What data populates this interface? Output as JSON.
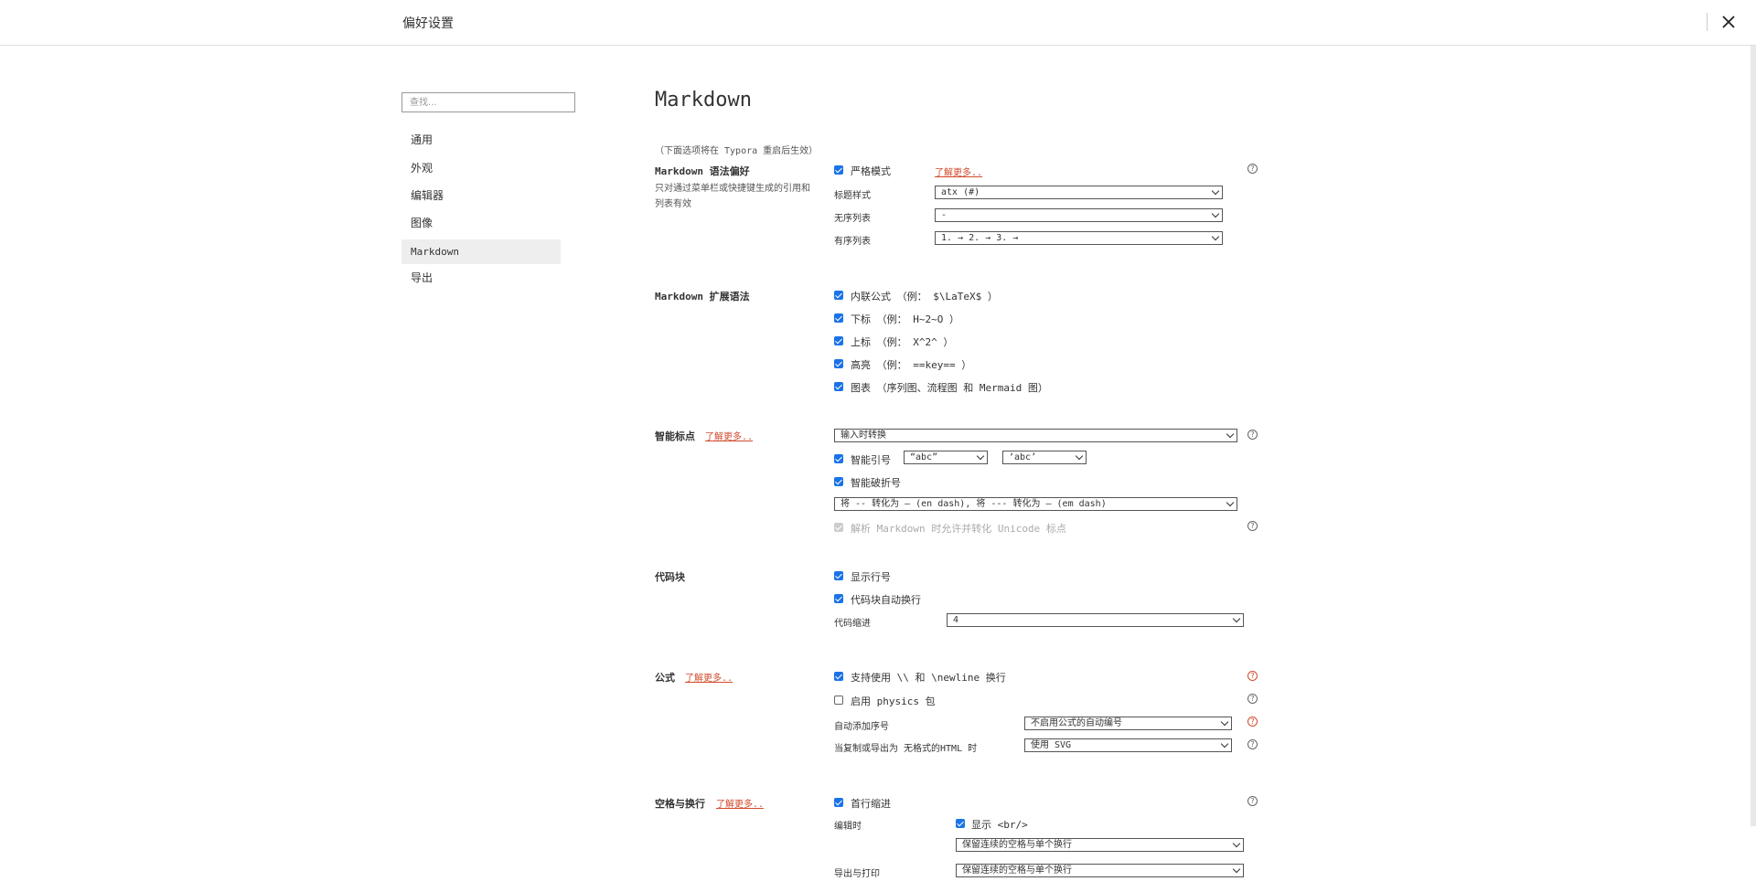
{
  "window": {
    "title": "偏好设置",
    "close_icon": "close-icon"
  },
  "search": {
    "placeholder": "查找..."
  },
  "sidebar": {
    "items": [
      {
        "label": "通用"
      },
      {
        "label": "外观"
      },
      {
        "label": "编辑器"
      },
      {
        "label": "图像"
      },
      {
        "label": "Markdown",
        "active": true
      },
      {
        "label": "导出"
      }
    ]
  },
  "page": {
    "title": "Markdown",
    "restart_note": "（下面选项将在 Typora 重启后生效）"
  },
  "syntax_pref": {
    "title": "Markdown 语法偏好",
    "desc": "只对通过菜单栏或快捷键生成的引用和列表有效",
    "strict_label": "严格模式",
    "learn_more": "了解更多..",
    "heading_style_label": "标题样式",
    "heading_style_value": "atx (#)",
    "unordered_label": "无序列表",
    "unordered_value": "-",
    "ordered_label": "有序列表",
    "ordered_value": "1. → 2. → 3. →"
  },
  "ext_syntax": {
    "title": "Markdown 扩展语法",
    "items": [
      "内联公式 （例： $\\LaTeX$ ）",
      "下标 （例： H~2~O ）",
      "上标 （例： X^2^ ）",
      "高亮 （例： ==key== ）",
      "图表  （序列图、流程图 和 Mermaid 图）"
    ]
  },
  "smart_punct": {
    "title": "智能标点",
    "learn_more": "了解更多..",
    "mode_value": "输入时转换",
    "smart_quotes_label": "智能引号",
    "double_quote_value": "“abc”",
    "single_quote_value": "‘abc’",
    "smart_dash_label": "智能破折号",
    "dash_value": "将 -- 转化为 – (en dash), 将 --- 转化为 — (em dash)",
    "unicode_label": "解析 Markdown 时允许并转化 Unicode 标点"
  },
  "code_block": {
    "title": "代码块",
    "line_numbers_label": "显示行号",
    "wrap_label": "代码块自动换行",
    "indent_label": "代码缩进",
    "indent_value": "4"
  },
  "math": {
    "title": "公式",
    "learn_more": "了解更多..",
    "newline_label": "支持使用 \\\\ 和 \\newline 换行",
    "physics_label": "启用 physics 包",
    "auto_number_label": "自动添加序号",
    "auto_number_value": "不启用公式的自动编号",
    "export_label": "当复制或导出为 无格式的HTML 时",
    "export_value": "使用 SVG"
  },
  "whitespace": {
    "title": "空格与换行",
    "learn_more": "了解更多..",
    "first_indent_label": "首行缩进",
    "edit_label": "编辑时",
    "show_br_label": "显示 <br/>",
    "edit_value": "保留连续的空格与单个换行",
    "export_label": "导出与打印",
    "export_value": "保留连续的空格与单个换行"
  },
  "colors": {
    "accent": "#1a73e8",
    "link": "#d24a2c"
  }
}
